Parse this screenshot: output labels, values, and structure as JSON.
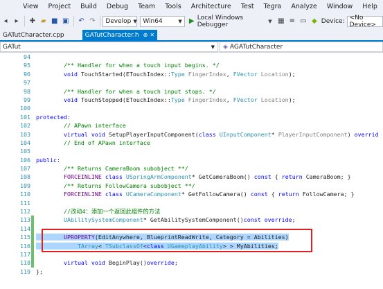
{
  "menu": [
    "View",
    "Project",
    "Build",
    "Debug",
    "Team",
    "Tools",
    "Architecture",
    "Test",
    "Tegra",
    "Analyze",
    "Window",
    "Help"
  ],
  "toolbar": {
    "config": "Develop",
    "platform": "Win64",
    "run_label": "Local Windows Debugger",
    "device_label": "Device:",
    "device_value": "<No Device>"
  },
  "tabs": [
    {
      "label": "GATutCharacter.cpp",
      "active": false
    },
    {
      "label": "GATutCharacter.h",
      "active": true
    }
  ],
  "nav": {
    "scope": "GATut",
    "member": "AGATutCharacter"
  },
  "lines": [
    {
      "n": "94",
      "tokens": []
    },
    {
      "n": "95",
      "tokens": [
        [
          "cm",
          "        /** Handler for when a touch input begins. */"
        ]
      ]
    },
    {
      "n": "96",
      "tokens": [
        [
          "kw",
          "        void "
        ],
        [
          "plain",
          "TouchStarted(ETouchIndex::"
        ],
        [
          "ty",
          "Type"
        ],
        [
          "plain",
          " "
        ],
        [
          "pa",
          "FingerIndex"
        ],
        [
          "plain",
          ", "
        ],
        [
          "ty",
          "FVector"
        ],
        [
          "plain",
          " "
        ],
        [
          "pa",
          "Location"
        ],
        [
          "plain",
          ");"
        ]
      ]
    },
    {
      "n": "97",
      "tokens": []
    },
    {
      "n": "98",
      "tokens": [
        [
          "cm",
          "        /** Handler for when a touch input stops. */"
        ]
      ]
    },
    {
      "n": "99",
      "tokens": [
        [
          "kw",
          "        void "
        ],
        [
          "plain",
          "TouchStopped(ETouchIndex::"
        ],
        [
          "ty",
          "Type"
        ],
        [
          "plain",
          " "
        ],
        [
          "pa",
          "FingerIndex"
        ],
        [
          "plain",
          ", "
        ],
        [
          "ty",
          "FVector"
        ],
        [
          "plain",
          " "
        ],
        [
          "pa",
          "Location"
        ],
        [
          "plain",
          ");"
        ]
      ]
    },
    {
      "n": "100",
      "tokens": []
    },
    {
      "n": "101",
      "tokens": [
        [
          "kw",
          "protected"
        ],
        [
          "plain",
          ":"
        ]
      ]
    },
    {
      "n": "102",
      "tokens": [
        [
          "cm",
          "        // APawn interface"
        ]
      ]
    },
    {
      "n": "103",
      "tokens": [
        [
          "kw",
          "        virtual void "
        ],
        [
          "plain",
          "SetupPlayerInputComponent("
        ],
        [
          "kw",
          "class "
        ],
        [
          "ty",
          "UInputComponent"
        ],
        [
          "plain",
          "* "
        ],
        [
          "pa",
          "PlayerInputComponent"
        ],
        [
          "plain",
          ") "
        ],
        [
          "kw",
          "overrid"
        ]
      ]
    },
    {
      "n": "104",
      "tokens": [
        [
          "cm",
          "        // End of APawn interface"
        ]
      ]
    },
    {
      "n": "105",
      "tokens": []
    },
    {
      "n": "106",
      "tokens": [
        [
          "kw",
          "public"
        ],
        [
          "plain",
          ":"
        ]
      ]
    },
    {
      "n": "107",
      "tokens": [
        [
          "cm",
          "        /** Returns CameraBoom subobject **/"
        ]
      ]
    },
    {
      "n": "108",
      "tokens": [
        [
          "mc",
          "        FORCEINLINE "
        ],
        [
          "kw",
          "class "
        ],
        [
          "ty",
          "USpringArmComponent"
        ],
        [
          "plain",
          "* GetCameraBoom() "
        ],
        [
          "kw",
          "const"
        ],
        [
          "plain",
          " { "
        ],
        [
          "kw",
          "return "
        ],
        [
          "plain",
          "CameraBoom; }"
        ]
      ]
    },
    {
      "n": "109",
      "tokens": [
        [
          "cm",
          "        /** Returns FollowCamera subobject **/"
        ]
      ]
    },
    {
      "n": "110",
      "tokens": [
        [
          "mc",
          "        FORCEINLINE "
        ],
        [
          "kw",
          "class "
        ],
        [
          "ty",
          "UCameraComponent"
        ],
        [
          "plain",
          "* GetFollowCamera() "
        ],
        [
          "kw",
          "const"
        ],
        [
          "plain",
          " { "
        ],
        [
          "kw",
          "return "
        ],
        [
          "plain",
          "FollowCamera; }"
        ]
      ]
    },
    {
      "n": "111",
      "tokens": []
    },
    {
      "n": "112",
      "tokens": [
        [
          "cm",
          "        //改动4：添加一个返回此组件的方法"
        ]
      ]
    },
    {
      "n": "113",
      "tokens": [
        [
          "ty",
          "        UAbilitySystemComponent"
        ],
        [
          "plain",
          "* GetAbilitySystemComponent()"
        ],
        [
          "kw",
          "const override"
        ],
        [
          "plain",
          ";"
        ]
      ]
    },
    {
      "n": "114",
      "tokens": []
    },
    {
      "n": "115",
      "tokens": [
        [
          "mc",
          "        UPROPERTY"
        ],
        [
          "plain",
          "(EditAnywhere, BlueprintReadWrite, Category = Abilities)"
        ]
      ],
      "sel": true
    },
    {
      "n": "116",
      "tokens": [
        [
          "plain",
          "            "
        ],
        [
          "ty",
          "TArray"
        ],
        [
          "plain",
          "< "
        ],
        [
          "ty",
          "TSubclassOf"
        ],
        [
          "plain",
          "<"
        ],
        [
          "kw",
          "class "
        ],
        [
          "ty",
          "UGameplayAbility"
        ],
        [
          "plain",
          "> > MyAbilities;"
        ]
      ],
      "sel": true
    },
    {
      "n": "117",
      "tokens": []
    },
    {
      "n": "118",
      "tokens": [
        [
          "kw",
          "        virtual void "
        ],
        [
          "plain",
          "BeginPlay()"
        ],
        [
          "kw",
          "override"
        ],
        [
          "plain",
          ";"
        ]
      ]
    },
    {
      "n": "119",
      "tokens": [
        [
          "plain",
          "};"
        ]
      ]
    }
  ]
}
